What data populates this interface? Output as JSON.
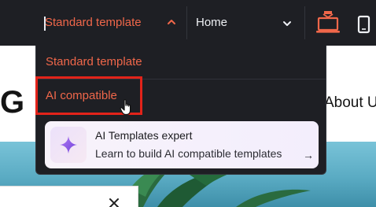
{
  "toolbar": {
    "template_select": {
      "value": "Standard template",
      "icon": "chevron-up-icon"
    },
    "page_select": {
      "value": "Home",
      "icon": "chevron-down-icon"
    },
    "device_buttons": [
      {
        "name": "desktop-view",
        "icon": "desktop-icon",
        "active": true
      },
      {
        "name": "mobile-view",
        "icon": "mobile-icon",
        "active": false
      }
    ]
  },
  "dropdown": {
    "options": [
      {
        "label": "Standard template"
      },
      {
        "label": "AI compatible",
        "hovered": true
      }
    ],
    "promo": {
      "title": "AI Templates expert",
      "description": "Learn to build AI compatible templates",
      "arrow": "→",
      "icon": "sparkle-icon"
    }
  },
  "page": {
    "logo_text": "G",
    "nav_link": "About U"
  },
  "colors": {
    "toolbar_bg": "#1e1f24",
    "accent": "#f0674a",
    "highlight_border": "#e2231a",
    "promo_bg": "#f6f1fc",
    "sparkle": "#8b5cf6"
  }
}
